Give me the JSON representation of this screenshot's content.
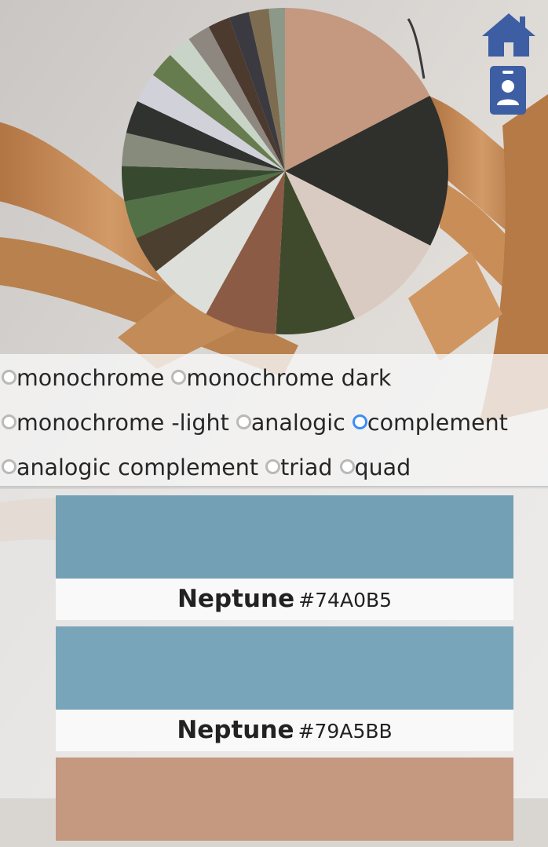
{
  "nav": {
    "home_icon_color": "#3d5ea3",
    "profile_icon_color": "#3d5ea3"
  },
  "palette_wheel_colors": [
    "#c59880",
    "#2f302c",
    "#d9cbc1",
    "#3f4a2c",
    "#8b5b45",
    "#dddfda",
    "#4b4030",
    "#527147",
    "#374a2f",
    "#878b7b",
    "#2f322e",
    "#d1d1da",
    "#677c4e",
    "#c8d4c7",
    "#8e8780",
    "#4d3a2f",
    "#3b3a40",
    "#7d6c50",
    "#8c9888"
  ],
  "scheme_options": {
    "items": [
      {
        "label": "monochrome",
        "checked": false
      },
      {
        "label": "monochrome dark",
        "checked": false
      },
      {
        "label": "monochrome -light",
        "checked": false
      },
      {
        "label": "analogic",
        "checked": false
      },
      {
        "label": "complement",
        "checked": true
      },
      {
        "label": "analogic complement",
        "checked": false
      },
      {
        "label": "triad",
        "checked": false
      },
      {
        "label": "quad",
        "checked": false
      }
    ],
    "accent_color": "#3d8df5"
  },
  "swatches": [
    {
      "name": "Neptune",
      "hex": "#74A0B5",
      "color": "#74A0B5"
    },
    {
      "name": "Neptune",
      "hex": "#79A5BB",
      "color": "#79A5BB"
    },
    {
      "name": "",
      "hex": "",
      "color": "#C59880"
    }
  ]
}
